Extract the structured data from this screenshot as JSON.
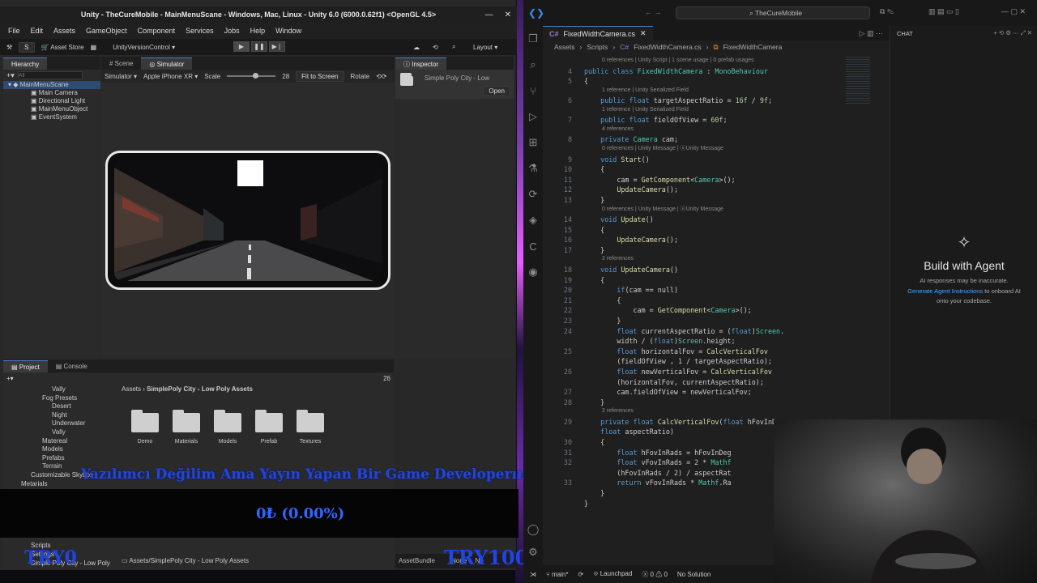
{
  "unity": {
    "title": "Unity - TheCureMobile - MainMenuScane - Windows, Mac, Linux - Unity 6.0 (6000.0.62f1) <OpenGL 4.5>",
    "menu": [
      "File",
      "Edit",
      "Assets",
      "GameObject",
      "Component",
      "Services",
      "Jobs",
      "Help",
      "Window"
    ],
    "toolbar": {
      "account": "S",
      "asset_store": "Asset Store",
      "version_control": "UnityVersionControl",
      "layout": "Layout"
    },
    "hierarchy": {
      "tab": "Hierarchy",
      "search_placeholder": "All",
      "items": [
        "MainMenuScane",
        "Main Camera",
        "Directional Light",
        "MainMenuObject",
        "EventSystem"
      ]
    },
    "scene_tabs": [
      "Scene",
      "Simulator"
    ],
    "simulator": {
      "mode": "Simulator",
      "device": "Apple iPhone XR",
      "scale_label": "Scale",
      "scale_value": "28",
      "fit": "Fit to Screen",
      "rotate": "Rotate"
    },
    "inspector": {
      "tab": "Inspector",
      "asset_name": "Simple Poly City - Low",
      "open": "Open"
    },
    "project": {
      "tabs": [
        "Project",
        "Console"
      ],
      "count": "26",
      "tree": [
        "Vally",
        "Fog Presets",
        "Desert",
        "Night",
        "Underwater",
        "Vally",
        "Matereal",
        "Models",
        "Prefabs",
        "Terrain",
        "Customizable Skybox",
        "Metarials",
        "Scripts",
        "Settings",
        "Simple Poly City - Low Poly"
      ],
      "breadcrumb": [
        "Assets",
        "SimplePoly City - Low Poly Assets"
      ],
      "folders": [
        "Demo",
        "Materials",
        "Models",
        "Prefab",
        "Textures"
      ],
      "path": "Assets/SimplePoly City - Low Poly Assets"
    },
    "status": {
      "asset_bundle": "AssetBundle",
      "none": "None",
      "none2": "No"
    }
  },
  "overlay": {
    "message": "Yazılımcı Değilim Ama Yayın Yapan Bir Game Developerım",
    "percent": "0₺ (0.00%)",
    "left": "TRY0",
    "right": "TRY10000"
  },
  "vscode": {
    "search": "TheCureMobile",
    "tab": "FixedWidthCamera.cs",
    "crumbs": [
      "Assets",
      "Scripts",
      "FixedWidthCamera.cs",
      "FixedWidthCamera"
    ],
    "lines": [
      {
        "lens": "0 references | Unity Script | 1 scene usage | 0 prefab usages"
      },
      {
        "n": "4",
        "code": "public class FixedWidthCamera : MonoBehaviour"
      },
      {
        "n": "5",
        "code": "{"
      },
      {
        "lens": "1 reference | Unity Serialized Field"
      },
      {
        "n": "6",
        "code": "    public float targetAspectRatio = 16f / 9f;"
      },
      {
        "lens": "1 reference | Unity Serialized Field"
      },
      {
        "n": "7",
        "code": "    public float fieldOfView = 60f;"
      },
      {
        "lens": "4 references"
      },
      {
        "n": "8",
        "code": "    private Camera cam;"
      },
      {
        "lens": "0 references | Unity Message | ⓤUnity Message"
      },
      {
        "n": "9",
        "code": "    void Start()"
      },
      {
        "n": "10",
        "code": "    {"
      },
      {
        "n": "11",
        "code": "        cam = GetComponent<Camera>();"
      },
      {
        "n": "12",
        "code": "        UpdateCamera();"
      },
      {
        "n": "13",
        "code": "    }"
      },
      {
        "lens": "0 references | Unity Message | ⓤUnity Message"
      },
      {
        "n": "14",
        "code": "    void Update()"
      },
      {
        "n": "15",
        "code": "    {"
      },
      {
        "n": "16",
        "code": "        UpdateCamera();"
      },
      {
        "n": "17",
        "code": "    }"
      },
      {
        "lens": "2 references"
      },
      {
        "n": "18",
        "code": "    void UpdateCamera()"
      },
      {
        "n": "19",
        "code": "    {"
      },
      {
        "n": "20",
        "code": "        if(cam == null)"
      },
      {
        "n": "21",
        "code": "        {"
      },
      {
        "n": "22",
        "code": "            cam = GetComponent<Camera>();"
      },
      {
        "n": "23",
        "code": "        }"
      },
      {
        "n": "24",
        "code": "        float currentAspectRatio = (float)Screen."
      },
      {
        "n": "",
        "code": "        width / (float)Screen.height;"
      },
      {
        "n": "25",
        "code": "        float horizontalFov = CalcVerticalFov"
      },
      {
        "n": "",
        "code": "        (fieldOfView , 1 / targetAspectRatio);"
      },
      {
        "n": "26",
        "code": "        float newVerticalFov = CalcVerticalFov"
      },
      {
        "n": "",
        "code": "        (horizontalFov, currentAspectRatio);"
      },
      {
        "n": "27",
        "code": "        cam.fieldOfView = newVerticalFov;"
      },
      {
        "n": "28",
        "code": "    }"
      },
      {
        "lens": "2 references"
      },
      {
        "n": "29",
        "code": "    private float CalcVerticalFov(float hFovInDeg,"
      },
      {
        "n": "",
        "code": "    float aspectRatio)"
      },
      {
        "n": "30",
        "code": "    {"
      },
      {
        "n": "31",
        "code": "        float hFovInRads = hFovInDeg"
      },
      {
        "n": "32",
        "code": "        float vFovInRads = 2 * Mathf"
      },
      {
        "n": "",
        "code": "        (hFovInRads / 2) / aspectRat"
      },
      {
        "n": "33",
        "code": "        return vFovInRads * Mathf.Ra"
      },
      {
        "n": "",
        "code": "    }"
      },
      {
        "n": "",
        "code": "}"
      }
    ],
    "chat": {
      "tab": "CHAT",
      "heading": "Build with Agent",
      "warning": "AI responses may be inaccurate.",
      "link": "Generate Agent Instructions",
      "rest": " to onboard AI onto your codebase."
    },
    "status": {
      "branch": "main*",
      "launchpad": "Launchpad",
      "errors": "0",
      "warnings": "0",
      "solution": "No Solution"
    }
  }
}
